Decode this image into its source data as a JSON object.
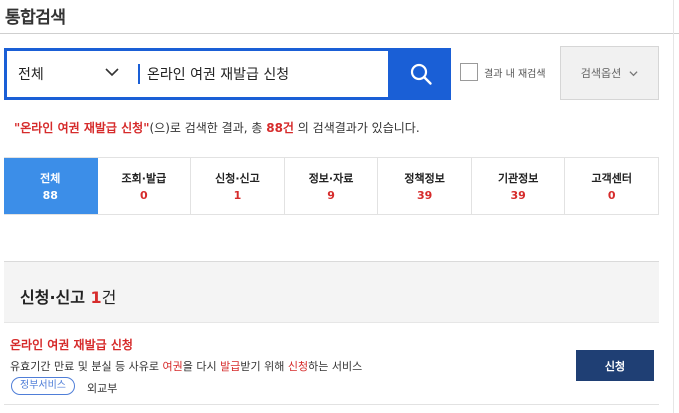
{
  "page": {
    "title": "통합검색"
  },
  "search": {
    "scope": "전체",
    "query": "온라인 여권 재발급 신청",
    "research_label": "결과 내 재검색",
    "options_label": "검색옵션"
  },
  "summary": {
    "open_quote": "\"",
    "keyword": "온라인 여권 재발급 신청",
    "close_quote": "\"",
    "text_a": "(으)로 검색한 결과, 총 ",
    "count": "88건",
    "text_b": " 의 검색결과가 있습니다."
  },
  "tabs": [
    {
      "label": "전체",
      "count": "88",
      "active": true
    },
    {
      "label": "조회·발급",
      "count": "0"
    },
    {
      "label": "신청·신고",
      "count": "1"
    },
    {
      "label": "정보·자료",
      "count": "9"
    },
    {
      "label": "정책정보",
      "count": "39"
    },
    {
      "label": "기관정보",
      "count": "39"
    },
    {
      "label": "고객센터",
      "count": "0"
    }
  ],
  "section": {
    "title": "신청·신고 ",
    "count": "1",
    "unit": "건"
  },
  "result": {
    "title": "온라인 여권 재발급 신청",
    "desc": [
      "유효기간 만료 및 분실 등 사유로 ",
      "여권",
      "을 다시 ",
      "발급",
      "받기 위해 ",
      "신청",
      "하는 서비스"
    ],
    "tag": "정부서비스",
    "agency": "외교부",
    "apply_label": "신청"
  },
  "colors": {
    "primary": "#1a5fd6",
    "active_tab": "#3c8ee8",
    "highlight": "#d62b2b",
    "apply": "#1f3f74"
  }
}
